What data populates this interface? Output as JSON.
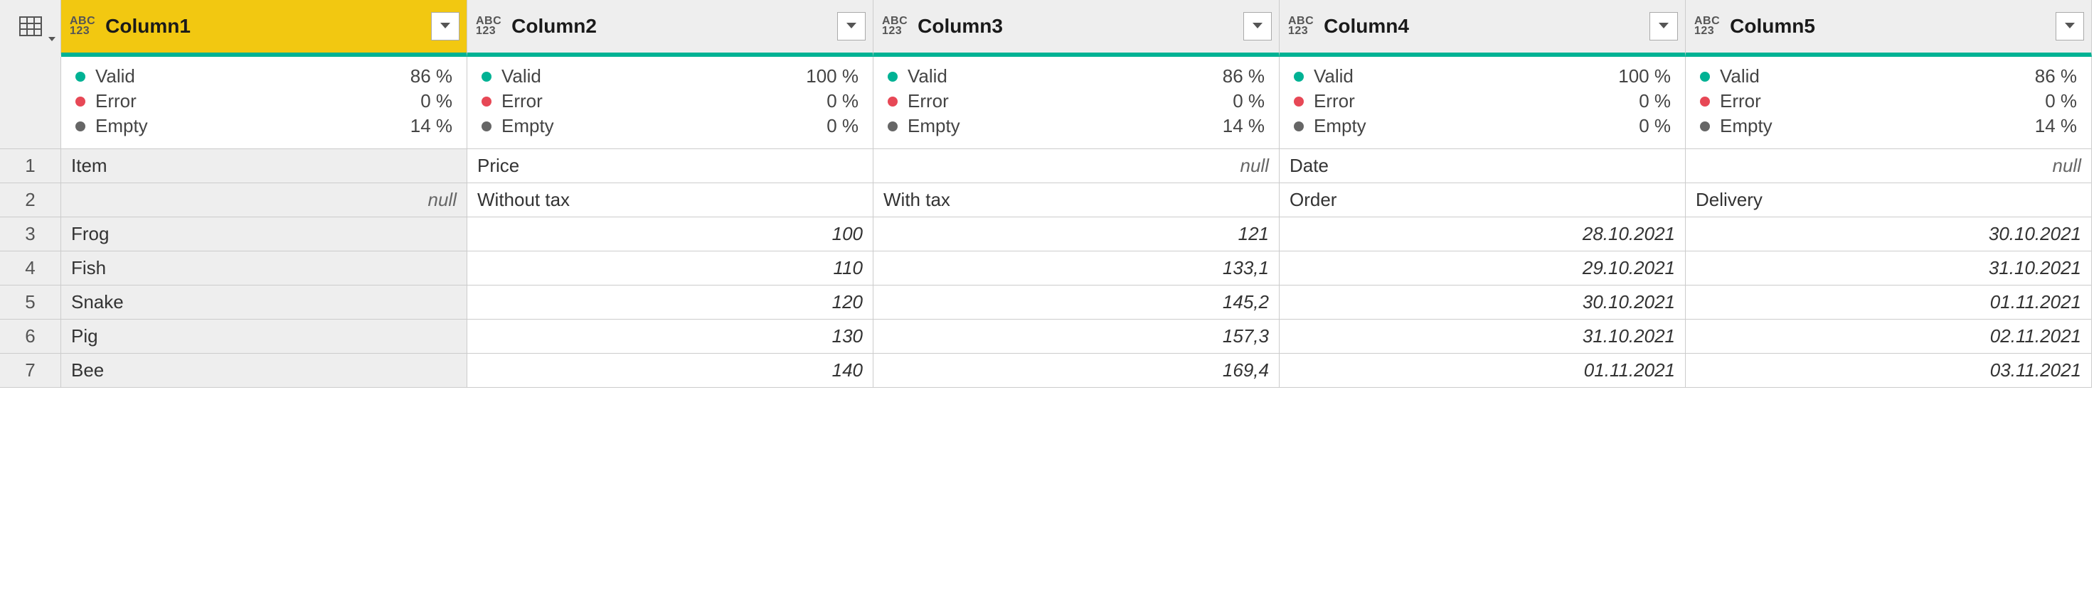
{
  "typeBadge": {
    "top": "ABC",
    "bottom": "123"
  },
  "columns": [
    {
      "name": "Column1",
      "selected": true,
      "quality": {
        "valid": "86 %",
        "error": "0 %",
        "empty": "14 %"
      }
    },
    {
      "name": "Column2",
      "selected": false,
      "quality": {
        "valid": "100 %",
        "error": "0 %",
        "empty": "0 %"
      }
    },
    {
      "name": "Column3",
      "selected": false,
      "quality": {
        "valid": "86 %",
        "error": "0 %",
        "empty": "14 %"
      }
    },
    {
      "name": "Column4",
      "selected": false,
      "quality": {
        "valid": "100 %",
        "error": "0 %",
        "empty": "0 %"
      }
    },
    {
      "name": "Column5",
      "selected": false,
      "quality": {
        "valid": "86 %",
        "error": "0 %",
        "empty": "14 %"
      }
    }
  ],
  "qualityLabels": {
    "valid": "Valid",
    "error": "Error",
    "empty": "Empty"
  },
  "rows": [
    {
      "n": "1",
      "cells": [
        {
          "v": "Item",
          "align": "left",
          "first": true
        },
        {
          "v": "Price",
          "align": "left"
        },
        {
          "v": "null",
          "align": "right",
          "null": true
        },
        {
          "v": "Date",
          "align": "left"
        },
        {
          "v": "null",
          "align": "right",
          "null": true
        }
      ]
    },
    {
      "n": "2",
      "cells": [
        {
          "v": "null",
          "align": "right",
          "first": true,
          "null": true
        },
        {
          "v": "Without tax",
          "align": "left"
        },
        {
          "v": "With tax",
          "align": "left"
        },
        {
          "v": "Order",
          "align": "left"
        },
        {
          "v": "Delivery",
          "align": "left"
        }
      ]
    },
    {
      "n": "3",
      "cells": [
        {
          "v": "Frog",
          "align": "left",
          "first": true
        },
        {
          "v": "100",
          "align": "right",
          "italic": true
        },
        {
          "v": "121",
          "align": "right",
          "italic": true
        },
        {
          "v": "28.10.2021",
          "align": "right",
          "italic": true
        },
        {
          "v": "30.10.2021",
          "align": "right",
          "italic": true
        }
      ]
    },
    {
      "n": "4",
      "cells": [
        {
          "v": "Fish",
          "align": "left",
          "first": true
        },
        {
          "v": "110",
          "align": "right",
          "italic": true
        },
        {
          "v": "133,1",
          "align": "right",
          "italic": true
        },
        {
          "v": "29.10.2021",
          "align": "right",
          "italic": true
        },
        {
          "v": "31.10.2021",
          "align": "right",
          "italic": true
        }
      ]
    },
    {
      "n": "5",
      "cells": [
        {
          "v": "Snake",
          "align": "left",
          "first": true
        },
        {
          "v": "120",
          "align": "right",
          "italic": true
        },
        {
          "v": "145,2",
          "align": "right",
          "italic": true
        },
        {
          "v": "30.10.2021",
          "align": "right",
          "italic": true
        },
        {
          "v": "01.11.2021",
          "align": "right",
          "italic": true
        }
      ]
    },
    {
      "n": "6",
      "cells": [
        {
          "v": "Pig",
          "align": "left",
          "first": true
        },
        {
          "v": "130",
          "align": "right",
          "italic": true
        },
        {
          "v": "157,3",
          "align": "right",
          "italic": true
        },
        {
          "v": "31.10.2021",
          "align": "right",
          "italic": true
        },
        {
          "v": "02.11.2021",
          "align": "right",
          "italic": true
        }
      ]
    },
    {
      "n": "7",
      "cells": [
        {
          "v": "Bee",
          "align": "left",
          "first": true
        },
        {
          "v": "140",
          "align": "right",
          "italic": true
        },
        {
          "v": "169,4",
          "align": "right",
          "italic": true
        },
        {
          "v": "01.11.2021",
          "align": "right",
          "italic": true
        },
        {
          "v": "03.11.2021",
          "align": "right",
          "italic": true
        }
      ]
    }
  ]
}
